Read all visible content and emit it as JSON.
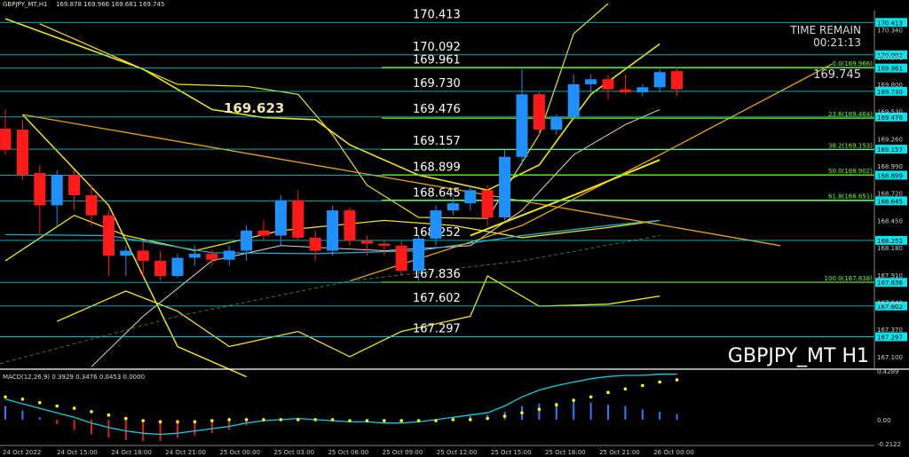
{
  "header": {
    "symbol_line": "GBPJPY_MT,H1",
    "ohlc": "169.878 169.966 169.681 169.745"
  },
  "timer": {
    "label": "TIME REMAIN",
    "value": "00:21:13"
  },
  "current_price": "169.745",
  "symbol_watermark": "GBPJPY_MT H1",
  "pivot_label": "169.623",
  "macd_label": "MACD(12,26,9) 0.3929 0.3476 0.0453 0.0000",
  "colors": {
    "background": "#000000",
    "bull_candle": "#1e90ff",
    "bear_candle": "#ff1a1a",
    "level_line": "#00e5ee",
    "ma_yellow": "#f2e312",
    "trend_orange": "#e8a400",
    "fib_green": "#7cfc00",
    "macd_line": "#00d0e0",
    "macd_signal": "#ffff00"
  },
  "chart_data": [
    {
      "type": "candlestick",
      "title": "GBPJPY_MT H1",
      "ylim": [
        167.011,
        170.53
      ],
      "yticks": [
        "170.340",
        "170.070",
        "169.800",
        "169.530",
        "169.260",
        "168.990",
        "168.720",
        "168.450",
        "168.180",
        "167.910",
        "167.640",
        "167.370",
        "167.100"
      ],
      "xticks": [
        "24 Oct 2022",
        "24 Oct 15:00",
        "24 Oct 18:00",
        "24 Oct 21:00",
        "25 Oct 00:00",
        "25 Oct 03:00",
        "25 Oct 06:00",
        "25 Oct 09:00",
        "25 Oct 12:00",
        "25 Oct 15:00",
        "25 Oct 18:00",
        "25 Oct 21:00",
        "26 Oct 00:00"
      ],
      "candles": [
        [
          169.36,
          169.55,
          169.1,
          169.15
        ],
        [
          169.35,
          169.45,
          168.85,
          168.9
        ],
        [
          168.92,
          169.0,
          168.3,
          168.6
        ],
        [
          168.6,
          168.95,
          168.4,
          168.9
        ],
        [
          168.9,
          168.95,
          168.55,
          168.7
        ],
        [
          168.7,
          168.8,
          168.4,
          168.5
        ],
        [
          168.5,
          168.55,
          167.9,
          168.1
        ],
        [
          168.1,
          168.2,
          167.9,
          168.15
        ],
        [
          168.15,
          168.25,
          167.9,
          168.05
        ],
        [
          168.05,
          168.15,
          167.85,
          167.9
        ],
        [
          167.9,
          168.12,
          167.88,
          168.08
        ],
        [
          168.08,
          168.2,
          168.0,
          168.12
        ],
        [
          168.12,
          168.16,
          168.0,
          168.06
        ],
        [
          168.06,
          168.2,
          168.0,
          168.15
        ],
        [
          168.15,
          168.4,
          168.05,
          168.35
        ],
        [
          168.35,
          168.45,
          168.25,
          168.3
        ],
        [
          168.3,
          168.7,
          168.2,
          168.65
        ],
        [
          168.65,
          168.75,
          168.25,
          168.28
        ],
        [
          168.28,
          168.35,
          168.05,
          168.15
        ],
        [
          168.15,
          168.6,
          168.1,
          168.55
        ],
        [
          168.55,
          168.58,
          168.2,
          168.25
        ],
        [
          168.25,
          168.3,
          168.1,
          168.22
        ],
        [
          168.22,
          168.25,
          168.1,
          168.2
        ],
        [
          168.2,
          168.25,
          167.9,
          167.95
        ],
        [
          167.95,
          168.3,
          167.85,
          168.27
        ],
        [
          168.27,
          168.6,
          168.2,
          168.55
        ],
        [
          168.55,
          168.68,
          168.5,
          168.62
        ],
        [
          168.62,
          168.8,
          168.55,
          168.75
        ],
        [
          168.75,
          168.8,
          168.4,
          168.48
        ],
        [
          168.48,
          169.15,
          168.45,
          169.08
        ],
        [
          169.08,
          169.95,
          169.0,
          169.7
        ],
        [
          169.7,
          169.72,
          169.3,
          169.35
        ],
        [
          169.35,
          169.5,
          169.3,
          169.48
        ],
        [
          169.48,
          169.9,
          169.45,
          169.8
        ],
        [
          169.8,
          169.9,
          169.72,
          169.85
        ],
        [
          169.85,
          169.9,
          169.65,
          169.75
        ],
        [
          169.75,
          169.9,
          169.7,
          169.72
        ],
        [
          169.72,
          169.8,
          169.68,
          169.77
        ],
        [
          169.77,
          169.95,
          169.72,
          169.92
        ],
        [
          169.93,
          169.97,
          169.68,
          169.75
        ]
      ],
      "levels": [
        {
          "price": 170.413,
          "label": "170.413"
        },
        {
          "price": 170.092,
          "label": "170.092"
        },
        {
          "price": 169.961,
          "label": "169.961"
        },
        {
          "price": 169.73,
          "label": "169.730"
        },
        {
          "price": 169.476,
          "label": "169.476"
        },
        {
          "price": 169.157,
          "label": "169.157"
        },
        {
          "price": 168.899,
          "label": "168.899"
        },
        {
          "price": 168.645,
          "label": "168.645"
        },
        {
          "price": 168.252,
          "label": "168.252"
        },
        {
          "price": 167.836,
          "label": "167.836"
        },
        {
          "price": 167.602,
          "label": "167.602"
        },
        {
          "price": 167.297,
          "label": "167.297"
        }
      ],
      "fib_levels": [
        {
          "price": 169.966,
          "label": "0.0(169.966)"
        },
        {
          "price": 169.464,
          "label": "23.6(169.464)"
        },
        {
          "price": 169.153,
          "label": "38.2(169.153)"
        },
        {
          "price": 168.902,
          "label": "50.0(168.902)"
        },
        {
          "price": 168.651,
          "label": "61.8(168.651)"
        },
        {
          "price": 167.838,
          "label": "100.0(167.838)"
        }
      ]
    },
    {
      "type": "macd",
      "ylim": [
        -0.2122,
        0.4289
      ],
      "yticks": [
        "0.4289",
        "0.00",
        "-0.2122"
      ],
      "histogram": [
        0.12,
        0.08,
        0.02,
        -0.04,
        -0.09,
        -0.13,
        -0.16,
        -0.18,
        -0.19,
        -0.19,
        -0.16,
        -0.14,
        -0.12,
        -0.09,
        -0.05,
        -0.02,
        0.0,
        0.01,
        0.0,
        -0.01,
        -0.02,
        -0.02,
        -0.03,
        -0.03,
        -0.02,
        0.0,
        0.02,
        0.03,
        0.04,
        0.07,
        0.12,
        0.14,
        0.15,
        0.16,
        0.15,
        0.13,
        0.12,
        0.09,
        0.07,
        0.05
      ],
      "macd": [
        0.18,
        0.14,
        0.1,
        0.06,
        0.02,
        -0.03,
        -0.07,
        -0.1,
        -0.12,
        -0.13,
        -0.12,
        -0.1,
        -0.08,
        -0.06,
        -0.03,
        -0.01,
        0.0,
        0.01,
        0.0,
        -0.01,
        -0.02,
        -0.02,
        -0.03,
        -0.03,
        -0.02,
        0.0,
        0.02,
        0.04,
        0.06,
        0.12,
        0.2,
        0.26,
        0.3,
        0.33,
        0.36,
        0.38,
        0.39,
        0.39,
        0.4,
        0.4
      ],
      "signal": [
        0.2,
        0.18,
        0.15,
        0.12,
        0.1,
        0.07,
        0.04,
        0.01,
        -0.01,
        -0.02,
        -0.02,
        -0.02,
        -0.01,
        0.0,
        0.0,
        0.0,
        0.0,
        0.0,
        0.0,
        0.0,
        -0.01,
        -0.01,
        -0.01,
        -0.01,
        -0.01,
        -0.01,
        0.0,
        0.0,
        0.01,
        0.03,
        0.06,
        0.09,
        0.13,
        0.17,
        0.2,
        0.24,
        0.27,
        0.3,
        0.33,
        0.35
      ]
    }
  ]
}
